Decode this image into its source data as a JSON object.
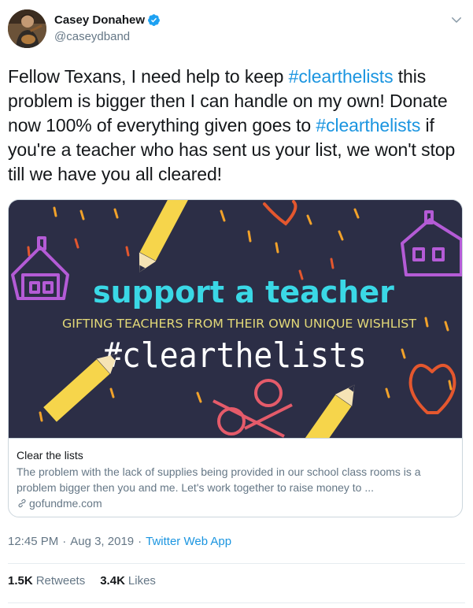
{
  "author": {
    "display_name": "Casey Donahew",
    "handle": "@caseydband",
    "verified": true
  },
  "tweet": {
    "segments": [
      {
        "text": "Fellow Texans, I need help to keep ",
        "type": "text"
      },
      {
        "text": "#clearthelists",
        "type": "hashtag"
      },
      {
        "text": "  this problem is bigger then I can handle on my own! Donate now 100% of everything given goes to ",
        "type": "text"
      },
      {
        "text": "#clearthelists",
        "type": "hashtag"
      },
      {
        "text": " if you're a teacher who has sent us your list, we won't stop till we have you all cleared!",
        "type": "text"
      }
    ]
  },
  "card": {
    "image": {
      "headline": "support a teacher",
      "subheadline": "GIFTING TEACHERS FROM THEIR OWN UNIQUE WISHLIST",
      "hashtag": "#clearthelists"
    },
    "title": "Clear the lists",
    "description": "The problem with the lack of supplies being provided in our school class rooms is a problem bigger then you and me. Let's work together to raise money to ...",
    "domain": "gofundme.com"
  },
  "meta": {
    "time": "12:45 PM",
    "separator": "·",
    "date": "Aug 3, 2019",
    "source": "Twitter Web App"
  },
  "stats": {
    "retweets_count": "1.5K",
    "retweets_label": "Retweets",
    "likes_count": "3.4K",
    "likes_label": "Likes"
  },
  "colors": {
    "link": "#1b95e0",
    "secondary_text": "#657786",
    "card_background": "#2c2e46",
    "accent_cyan": "#3ad8e6"
  },
  "icons": [
    "verified-badge-icon",
    "chevron-down-icon",
    "link-icon"
  ]
}
